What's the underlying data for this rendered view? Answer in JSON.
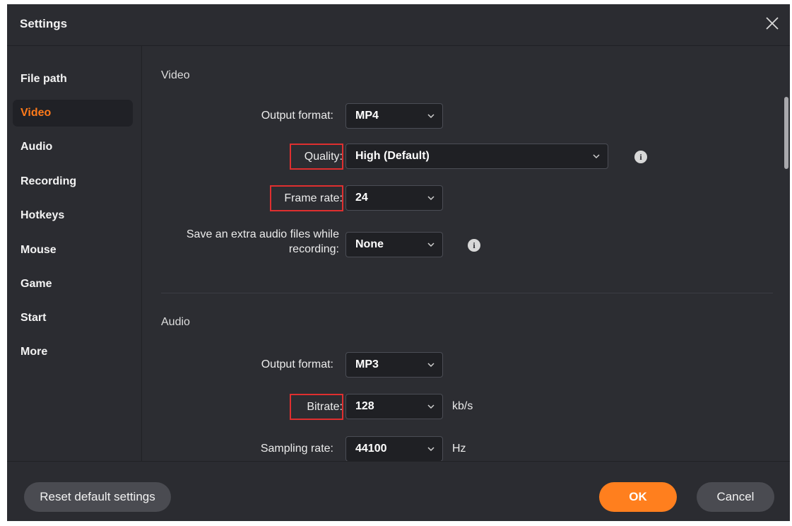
{
  "window": {
    "title": "Settings"
  },
  "sidebar": {
    "items": [
      {
        "label": "File path"
      },
      {
        "label": "Video"
      },
      {
        "label": "Audio"
      },
      {
        "label": "Recording"
      },
      {
        "label": "Hotkeys"
      },
      {
        "label": "Mouse"
      },
      {
        "label": "Game"
      },
      {
        "label": "Start"
      },
      {
        "label": "More"
      }
    ],
    "active": "Video"
  },
  "video": {
    "section_title": "Video",
    "output_format": {
      "label": "Output format:",
      "value": "MP4"
    },
    "quality": {
      "label": "Quality:",
      "value": "High (Default)"
    },
    "frame_rate": {
      "label": "Frame rate:",
      "value": "24"
    },
    "extra_audio": {
      "label": "Save an extra audio files while recording:",
      "value": "None"
    }
  },
  "audio": {
    "section_title": "Audio",
    "output_format": {
      "label": "Output format:",
      "value": "MP3"
    },
    "bitrate": {
      "label": "Bitrate:",
      "value": "128",
      "unit": "kb/s"
    },
    "sampling_rate": {
      "label": "Sampling rate:",
      "value": "44100",
      "unit": "Hz"
    }
  },
  "footer": {
    "reset_label": "Reset default settings",
    "ok_label": "OK",
    "cancel_label": "Cancel"
  },
  "icons": {
    "close": "close-icon",
    "info": "info-icon",
    "dropdown": "chevron-down-icon"
  },
  "colors": {
    "accent": "#ff7f1e",
    "active_nav_text": "#ff7a1a",
    "highlight_box": "#df2f2f",
    "background": "#2b2c31"
  }
}
